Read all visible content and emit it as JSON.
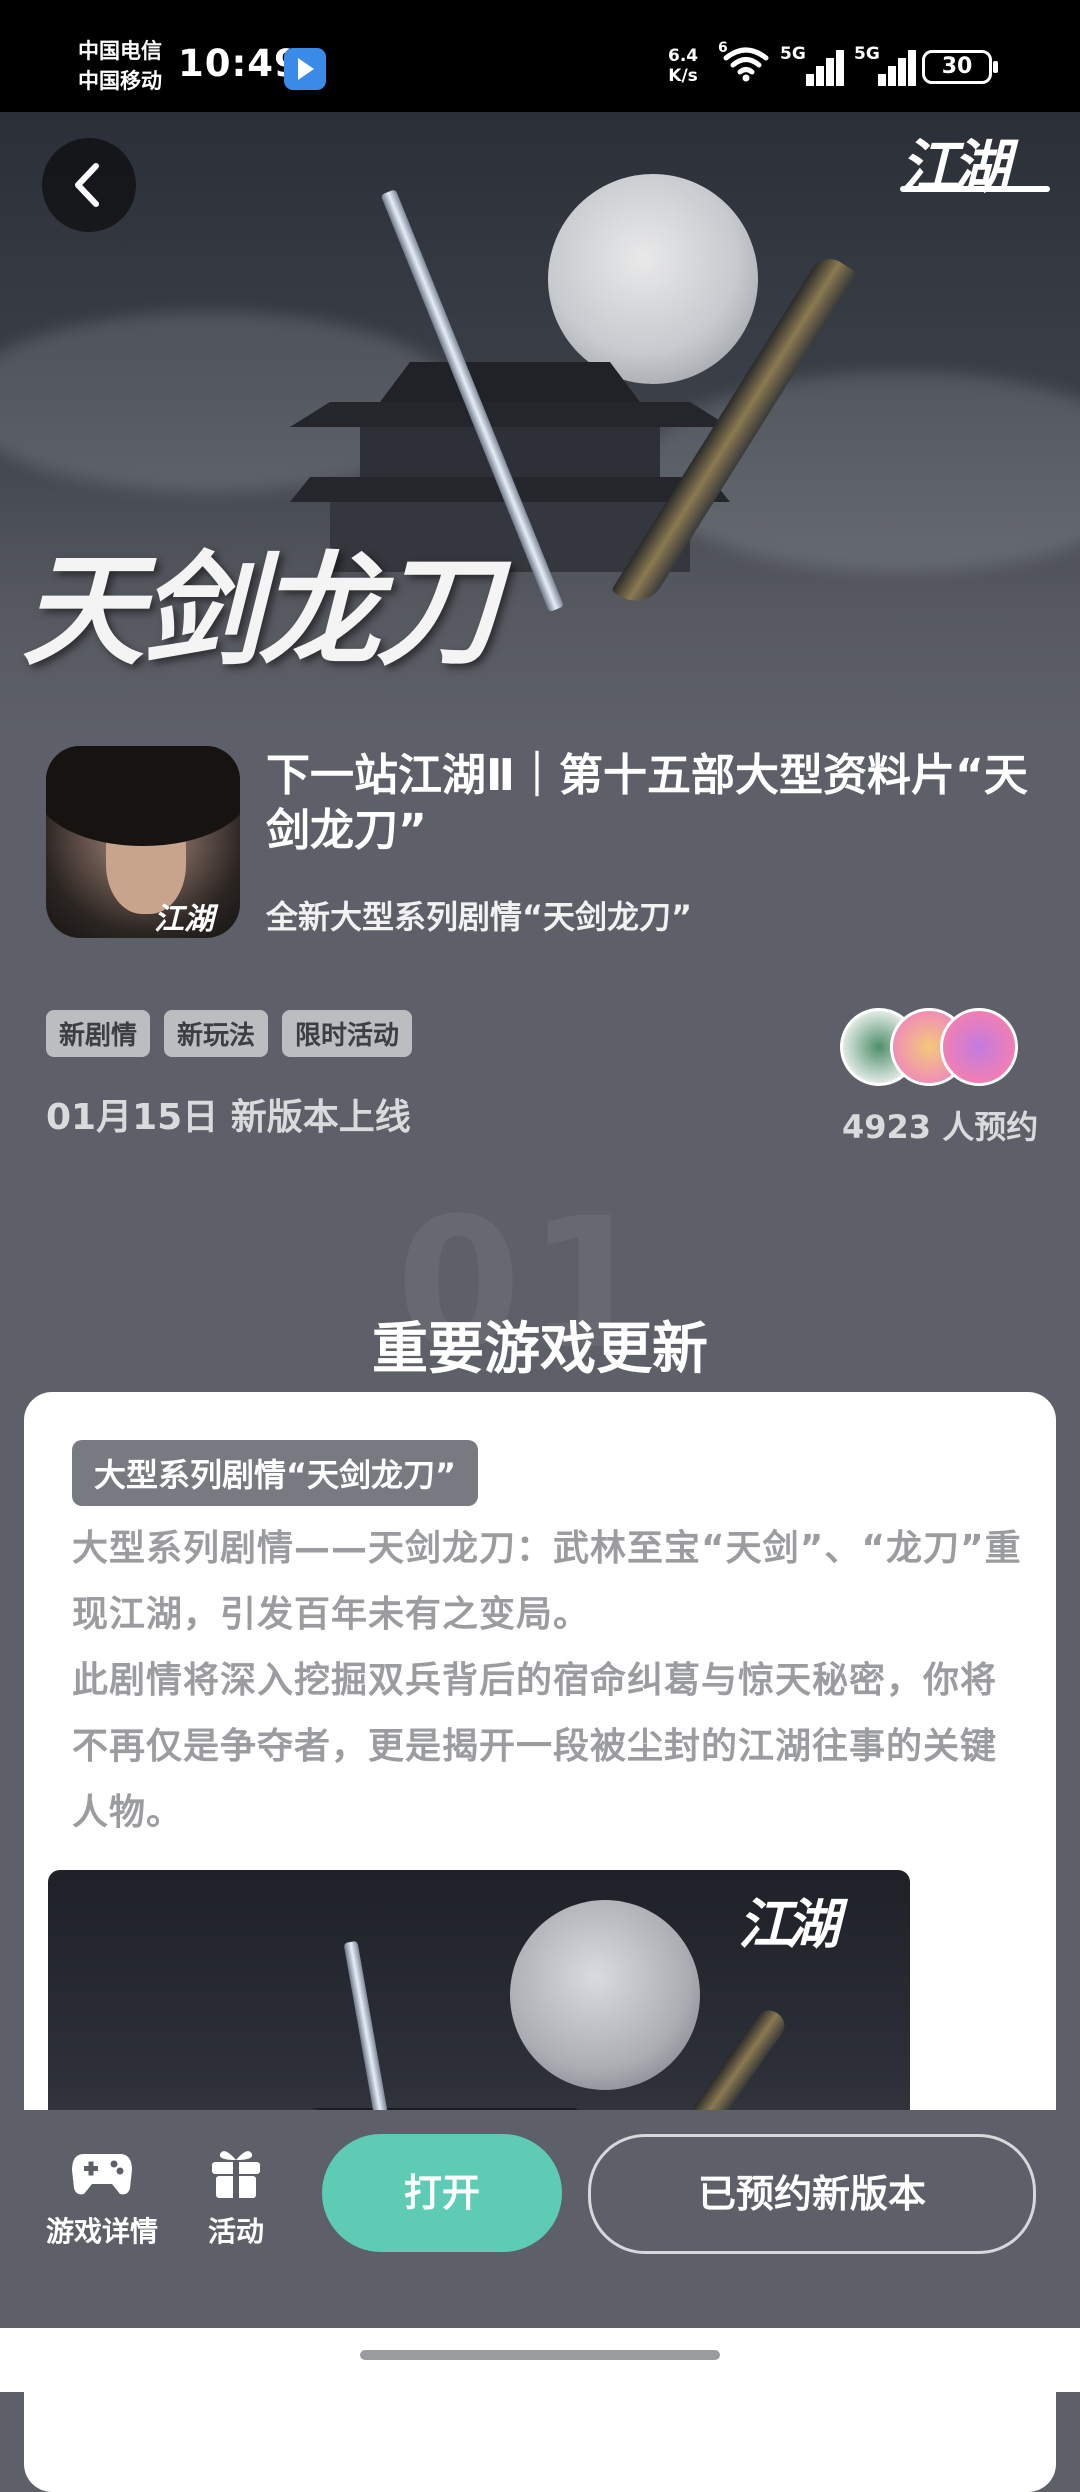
{
  "status_bar": {
    "carrier_1": "中国电信",
    "carrier_2": "中国移动",
    "time": "10:49",
    "net_speed_value": "6.4",
    "net_speed_unit": "K/s",
    "wifi_badge": "6",
    "sim1_label": "5G",
    "sim2_label": "5G",
    "battery": "30"
  },
  "hero": {
    "title_art": "天剑龙刀",
    "logo_text": "江湖"
  },
  "info": {
    "title": "下一站江湖Ⅱ｜第十五部大型资料片“天剑龙刀”",
    "subtitle": "全新大型系列剧情“天剑龙刀”",
    "tags": [
      "新剧情",
      "新玩法",
      "限时活动"
    ],
    "release": "01月15日 新版本上线",
    "reservations": "4923 人预约",
    "icon_logo": "江湖"
  },
  "section": {
    "number": "01",
    "title": "重要游戏更新"
  },
  "card": {
    "tag": "大型系列剧情“天剑龙刀”",
    "text": "大型系列剧情——天剑龙刀：武林至宝“天剑”、“龙刀”重现江湖，引发百年未有之变局。\n此剧情将深入挖掘双兵背后的宿命纠葛与惊天秘密，你将不再仅是争夺者，更是揭开一段被尘封的江湖往事的关键人物。",
    "image_logo": "江湖"
  },
  "bottom_bar": {
    "game_detail": "游戏详情",
    "activity": "活动",
    "open": "打开",
    "reserved": "已预约新版本"
  },
  "colors": {
    "page_bg": "#5d6068",
    "accent_green": "#5ecbb5",
    "tag_bg": "#bcbdc1",
    "card_tag_bg": "#777a80"
  }
}
